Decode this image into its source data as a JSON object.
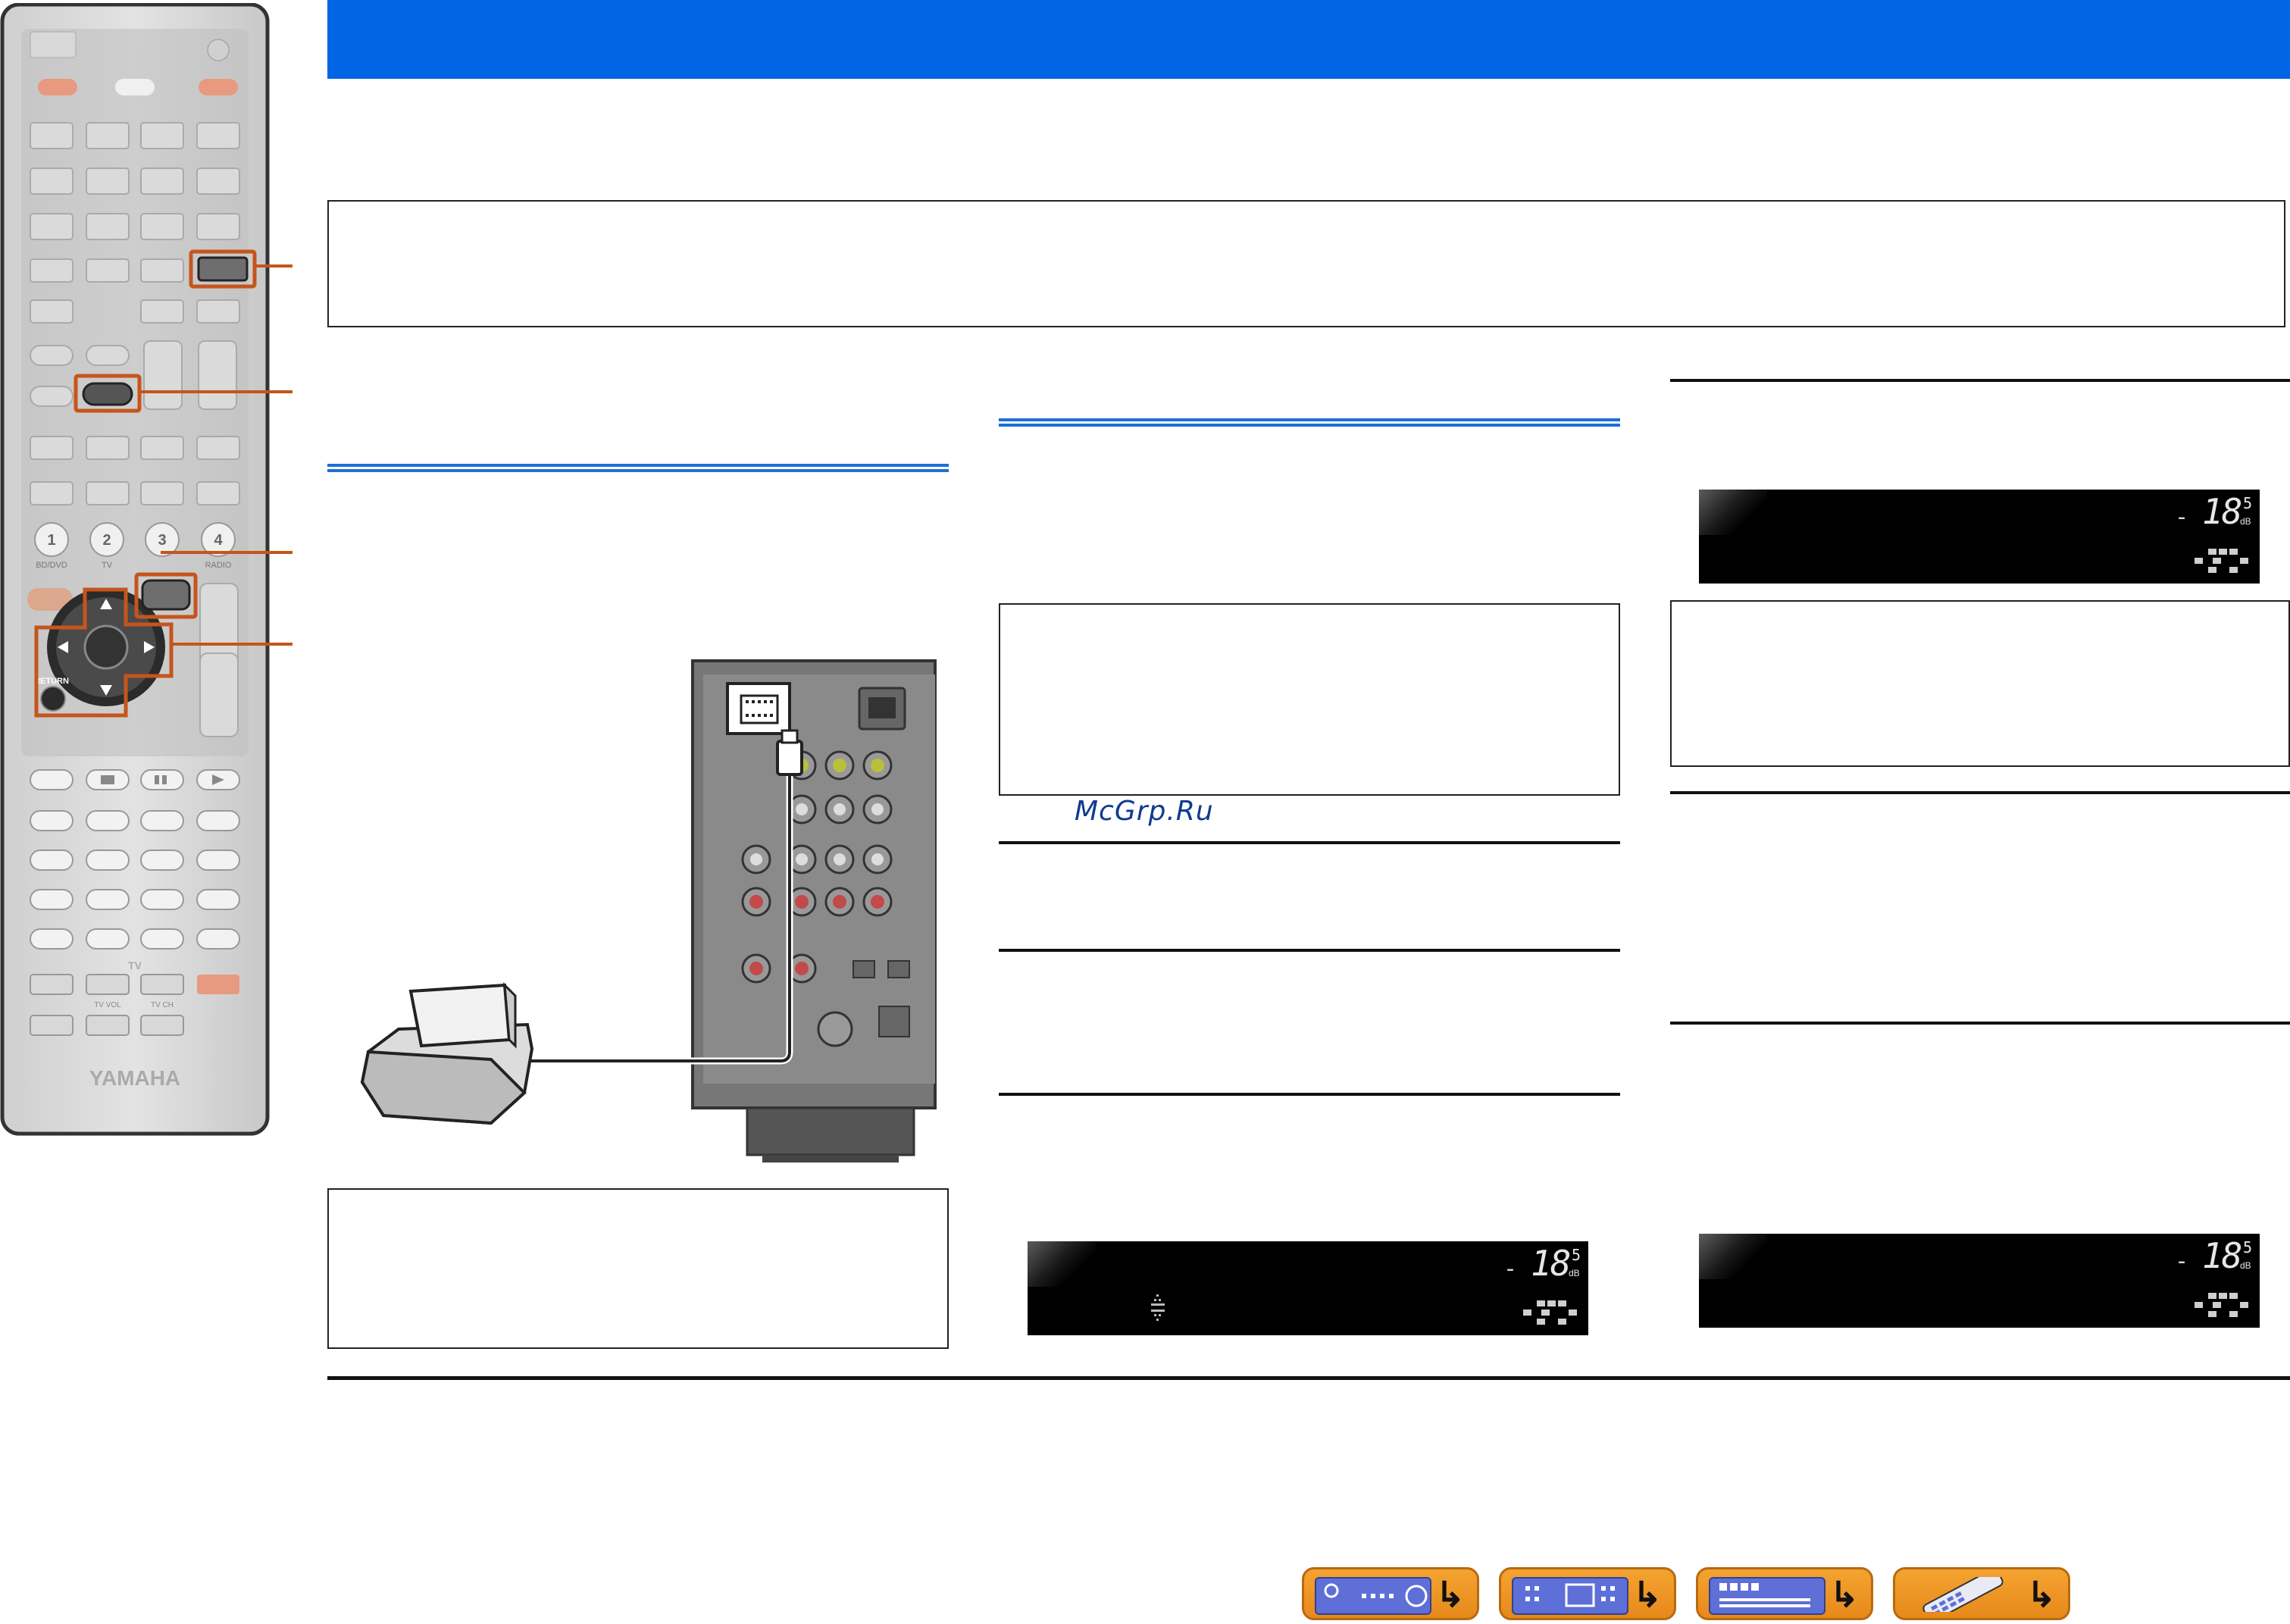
{
  "watermark": "McGrp.Ru",
  "remote": {
    "input_labels": [
      "BD/DVD",
      "TV",
      "",
      "RADIO"
    ],
    "number_keys": [
      "1",
      "2",
      "3",
      "4"
    ],
    "return_label": "RETURN",
    "tv_label": "TV",
    "tv_vol_label": "TV VOL",
    "tv_ch_label": "TV CH",
    "brand": "YAMAHA"
  },
  "displays": [
    {
      "minus": "-",
      "value": "18",
      "decimal": "5",
      "unit": "dB"
    },
    {
      "minus": "-",
      "value": "18",
      "decimal": "5",
      "unit": "dB"
    },
    {
      "minus": "-",
      "value": "18",
      "decimal": "5",
      "unit": "dB"
    }
  ],
  "nav_buttons": [
    {
      "icon": "receiver-front-icon"
    },
    {
      "icon": "receiver-rear-icon"
    },
    {
      "icon": "front-display-icon"
    },
    {
      "icon": "remote-control-icon"
    }
  ],
  "colors": {
    "header": "#0266e4",
    "accent_rule": "#1f6fd6",
    "highlight": "#c5551c",
    "nav_button": "#f4a331"
  }
}
